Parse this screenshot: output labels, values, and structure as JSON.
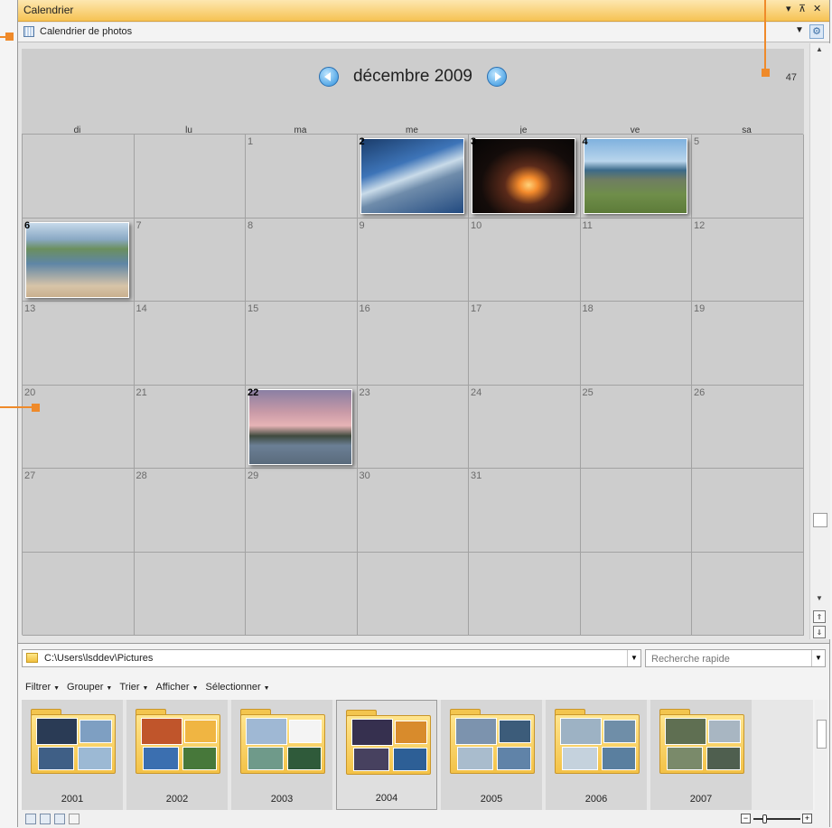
{
  "window": {
    "title": "Calendrier",
    "controls": [
      "▾",
      "⊼",
      "✕"
    ]
  },
  "viewbar": {
    "label": "Calendrier de photos"
  },
  "calendar": {
    "month_label": "décembre 2009",
    "week_number": "47",
    "day_headers": [
      "di",
      "lu",
      "ma",
      "me",
      "je",
      "ve",
      "sa"
    ],
    "weeks": [
      [
        "",
        "",
        "1",
        "2",
        "3",
        "4",
        "5"
      ],
      [
        "6",
        "7",
        "8",
        "9",
        "10",
        "11",
        "12"
      ],
      [
        "13",
        "14",
        "15",
        "16",
        "17",
        "18",
        "19"
      ],
      [
        "20",
        "21",
        "22",
        "23",
        "24",
        "25",
        "26"
      ],
      [
        "27",
        "28",
        "29",
        "30",
        "31",
        "",
        ""
      ],
      [
        "",
        "",
        "",
        "",
        "",
        "",
        ""
      ]
    ],
    "photo_days": [
      "2",
      "3",
      "4",
      "6",
      "22"
    ],
    "photos": {
      "2": "building-sky",
      "3": "palm-sunset",
      "4": "coastal-cliffs",
      "6": "seagull-beach",
      "22": "lake-dusk"
    }
  },
  "browser": {
    "path": "C:\\Users\\lsddev\\Pictures",
    "search_placeholder": "Recherche rapide",
    "menu": [
      "Filtrer",
      "Grouper",
      "Trier",
      "Afficher",
      "Sélectionner"
    ],
    "folders": [
      "2001",
      "2002",
      "2003",
      "2004",
      "2005",
      "2006",
      "2007"
    ],
    "selected_folder": "2004"
  },
  "colors": {
    "accent": "#ef8a2a",
    "titlebar": "#f6c354",
    "calendar_bg": "#cdcdcd"
  }
}
